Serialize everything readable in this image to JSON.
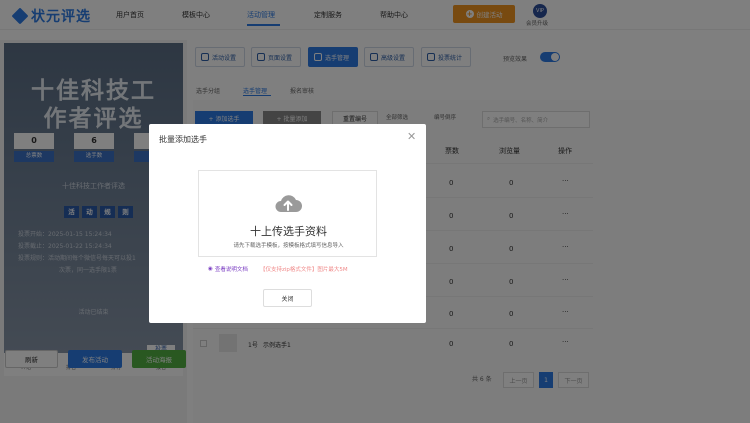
{
  "app": {
    "logo_text": "状元评选"
  },
  "nav": {
    "items": [
      "用户首页",
      "模板中心",
      "活动管理",
      "定制服务",
      "帮助中心"
    ],
    "active_index": 2
  },
  "header": {
    "create_button": "创建活动",
    "vip_badge": "VIP",
    "vip_label": "会员升级"
  },
  "preview": {
    "hero_line1": "十佳科技工",
    "hero_line2": "作者评选",
    "stats": [
      {
        "value": "0",
        "label": "总票数"
      },
      {
        "value": "6",
        "label": "选手数"
      }
    ],
    "subtitle": "十佳科技工作者评选",
    "rules_chars": [
      "活",
      "动",
      "规",
      "则"
    ],
    "rules": [
      "投票开始：2025-01-15 15:24:34",
      "投票截止：2025-01-22 15:24:34",
      "投票规则：活动期间每个微信号每天可以投1",
      "次票，同一选手限1票"
    ],
    "ended": "活动已结束",
    "vote_tag": "投票",
    "bottom_tabs": [
      "介绍",
      "排名",
      "排行",
      "报名"
    ]
  },
  "actions": {
    "refresh": "刷新",
    "publish": "发布活动",
    "data": "活动海报"
  },
  "menu": {
    "items": [
      "活动设置",
      "页面设置",
      "选手管理",
      "高级设置",
      "投票统计"
    ],
    "active_index": 2,
    "preview_label": "预览效果"
  },
  "subtabs": {
    "items": [
      "选手分组",
      "选手管理",
      "报名审核"
    ],
    "active_index": 1
  },
  "toolbar": {
    "add_player": "+ 添加选手",
    "batch_import": "+ 批量添加",
    "reset_numbers": "重置编号",
    "filter_all": "全部筛选",
    "sort": "编号倒序",
    "search_placeholder": "选手编号、名称、简介"
  },
  "table": {
    "headers": [
      "票数",
      "浏览量",
      "操作"
    ],
    "rows": [
      {
        "votes": "0",
        "views": "0",
        "op": "···"
      },
      {
        "votes": "0",
        "views": "0",
        "op": "···"
      },
      {
        "votes": "0",
        "views": "0",
        "op": "···"
      },
      {
        "votes": "0",
        "views": "0",
        "op": "···"
      },
      {
        "votes": "0",
        "views": "0",
        "op": "···"
      },
      {
        "number": "1号",
        "name": "示例选手1",
        "votes": "0",
        "views": "0",
        "op": "···"
      }
    ]
  },
  "pagination": {
    "total": "共 6 条",
    "prev": "上一页",
    "current": "1",
    "next": "下一页"
  },
  "modal": {
    "title": "批量添加选手",
    "upload_title": "十上传选手资料",
    "upload_hint": "请先下载选手模板，按模板格式填写信息导入",
    "doc_link": "查看说明文档",
    "doc_note": "【仅支持zip格式文件】图片最大5M",
    "close_button": "关闭"
  },
  "colors": {
    "primary": "#2d7be5",
    "orange": "#f09520",
    "green": "#52b043",
    "purple": "#7a3cc2"
  }
}
